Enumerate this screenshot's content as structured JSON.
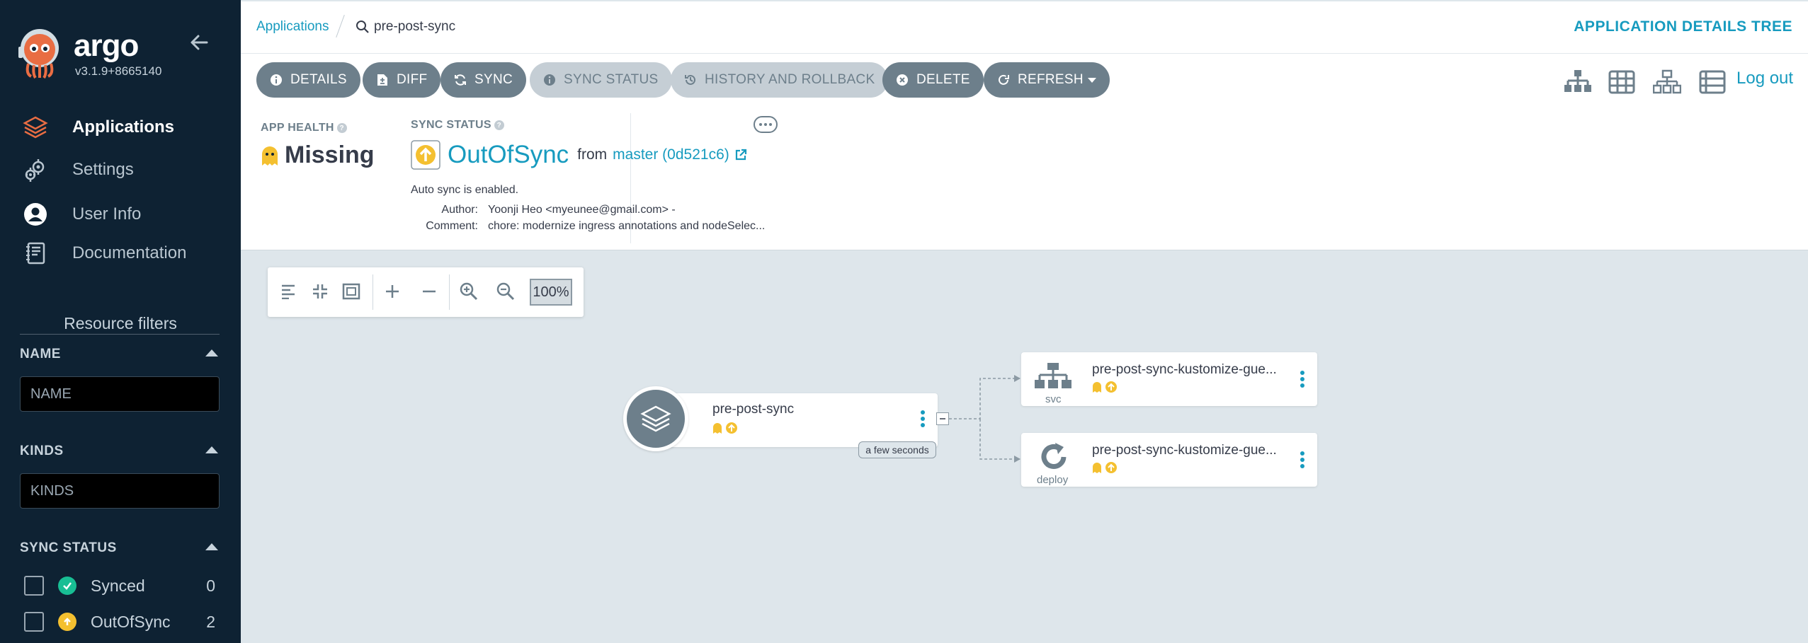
{
  "sidebar": {
    "brand": "argo",
    "version": "v3.1.9+8665140",
    "nav": [
      {
        "label": "Applications",
        "icon": "layers-icon",
        "active": true
      },
      {
        "label": "Settings",
        "icon": "gears-icon",
        "active": false
      },
      {
        "label": "User Info",
        "icon": "user-circle-icon",
        "active": false
      },
      {
        "label": "Documentation",
        "icon": "book-icon",
        "active": false
      }
    ],
    "filters": {
      "title": "Resource filters",
      "name_label": "NAME",
      "name_placeholder": "NAME",
      "kinds_label": "KINDS",
      "kinds_placeholder": "KINDS",
      "sync_status_label": "SYNC STATUS",
      "sync_items": [
        {
          "label": "Synced",
          "count": "0",
          "color": "#18be94"
        },
        {
          "label": "OutOfSync",
          "count": "2",
          "color": "#f4c030"
        }
      ]
    }
  },
  "header": {
    "breadcrumb_root": "Applications",
    "breadcrumb_current": "pre-post-sync",
    "page_title": "APPLICATION DETAILS TREE"
  },
  "toolbar": {
    "buttons": [
      {
        "label": "DETAILS",
        "icon": "info-icon",
        "enabled": true
      },
      {
        "label": "DIFF",
        "icon": "file-diff-icon",
        "enabled": true
      },
      {
        "label": "SYNC",
        "icon": "sync-icon",
        "enabled": true
      },
      {
        "label": "SYNC STATUS",
        "icon": "info-icon",
        "enabled": false
      },
      {
        "label": "HISTORY AND ROLLBACK",
        "icon": "history-icon",
        "enabled": false
      },
      {
        "label": "DELETE",
        "icon": "times-circle-icon",
        "enabled": true
      },
      {
        "label": "REFRESH",
        "icon": "redo-icon",
        "enabled": true
      }
    ],
    "logout": "Log out"
  },
  "status": {
    "app_health_label": "APP HEALTH",
    "app_health_value": "Missing",
    "sync_status_label": "SYNC STATUS",
    "sync_status_value": "OutOfSync",
    "from_text": "from",
    "revision": "master (0d521c6)",
    "auto_sync": "Auto sync is enabled.",
    "author_label": "Author:",
    "author_value": "Yoonji Heo <myeunee@gmail.com> -",
    "comment_label": "Comment:",
    "comment_value": "chore: modernize ingress annotations and nodeSelec..."
  },
  "graph": {
    "zoom": "100%",
    "app_node": {
      "name": "pre-post-sync",
      "age": "a few seconds"
    },
    "children": [
      {
        "name": "pre-post-sync-kustomize-gue...",
        "kind": "svc"
      },
      {
        "name": "pre-post-sync-kustomize-gue...",
        "kind": "deploy"
      }
    ]
  },
  "colors": {
    "sidebar_bg": "#0e2233",
    "accent": "#179bbf",
    "button": "#6d7f8b",
    "missing": "#f4c030",
    "synced": "#18be94"
  }
}
